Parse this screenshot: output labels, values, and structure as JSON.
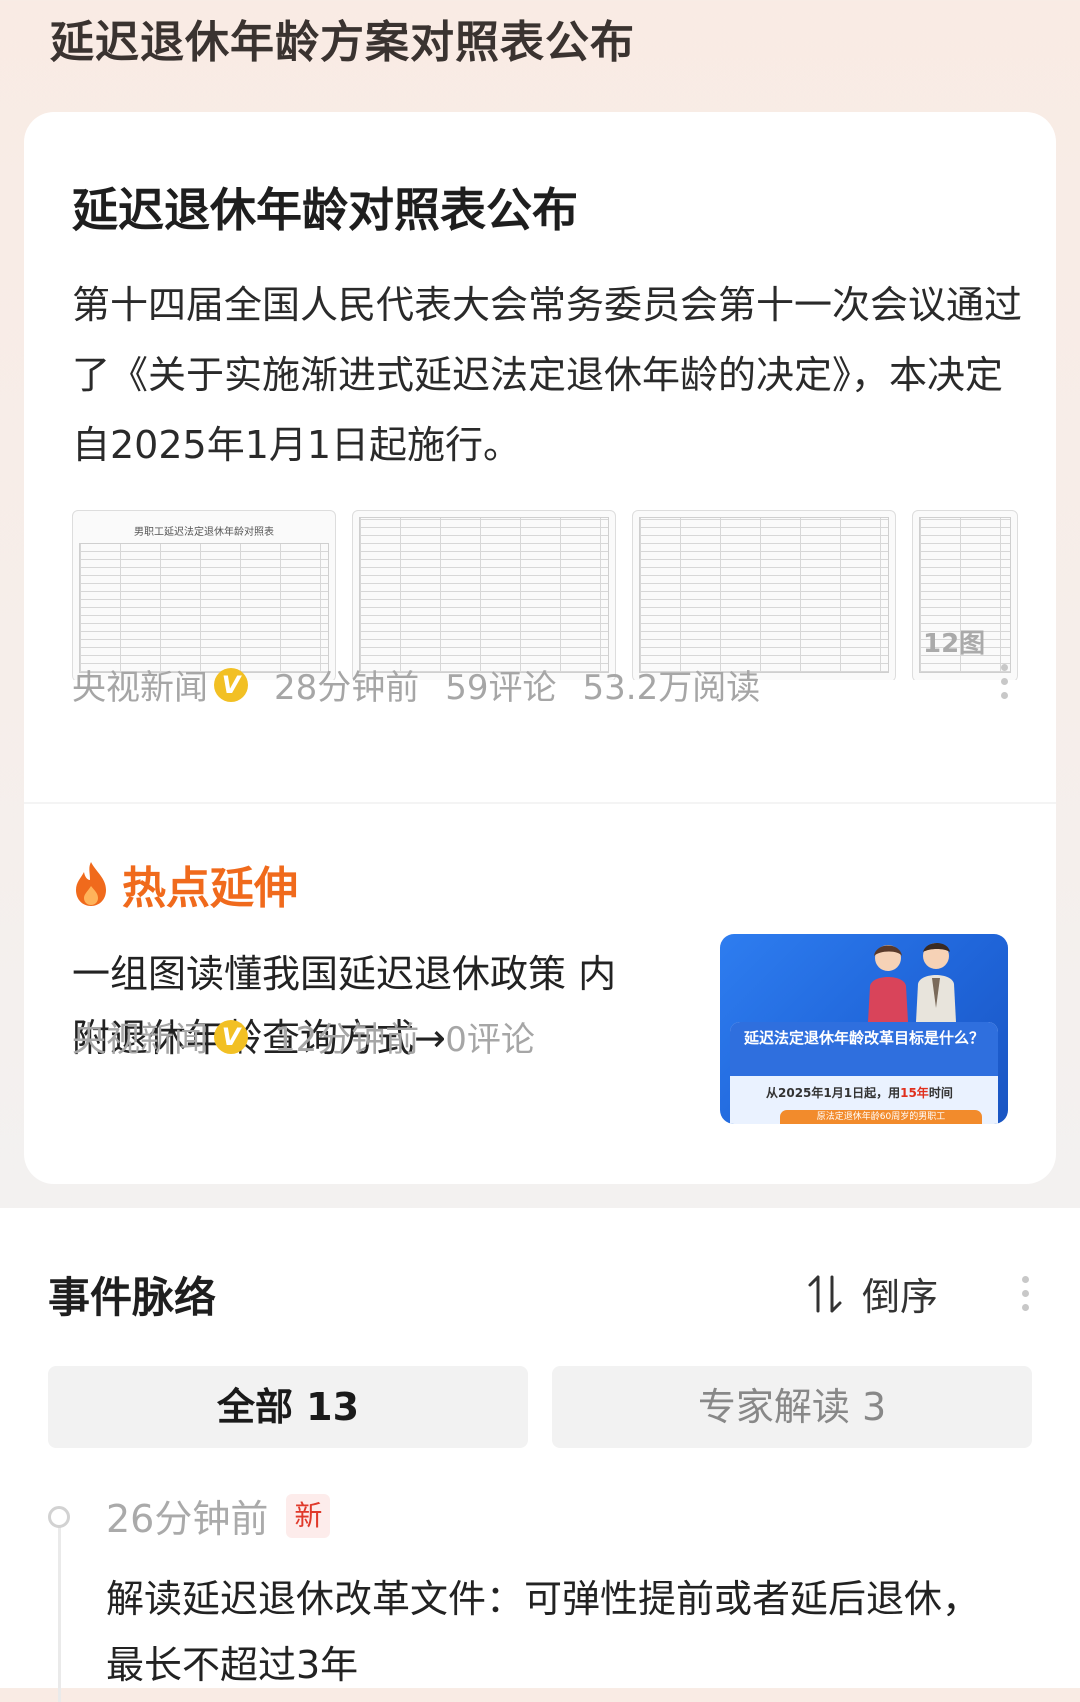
{
  "page_title": "延迟退休年龄方案对照表公布",
  "article": {
    "headline": "延迟退休年龄对照表公布",
    "summary": "第十四届全国人民代表大会常务委员会第十一次会议通过了《关于实施渐进式延迟法定退休年龄的决定》，本决定自2025年1月1日起施行。",
    "thumb_title": "男职工延迟法定退休年龄对照表",
    "image_count": "12图",
    "source": "央视新闻",
    "verified_badge": "V",
    "time": "28分钟前",
    "comments": "59评论",
    "reads": "53.2万阅读"
  },
  "hot_extension": {
    "heading": "热点延伸",
    "icon": "flame-icon",
    "title": "一组图读懂我国延迟退休政策 内附退休年龄查询方式→",
    "source": "央视新闻",
    "verified_badge": "V",
    "time": "12分钟前",
    "comments": "0评论",
    "image": {
      "title": "延迟法定退休年龄改革目标是什么？",
      "line_prefix": "从2025年1月1日起，用",
      "line_highlight": "15年",
      "line_suffix": "时间",
      "bar_text": "原法定退休年龄60周岁的男职工"
    }
  },
  "timeline": {
    "heading": "事件脉络",
    "sort_label": "倒序",
    "sort_icon": "sort-icon",
    "tabs": [
      {
        "label": "全部 13",
        "selected": true
      },
      {
        "label": "专家解读 3",
        "selected": false
      }
    ],
    "items": [
      {
        "time": "26分钟前",
        "badge": "新",
        "text": "解读延迟退休改革文件：可弹性提前或者延后退休，最长不超过3年"
      }
    ]
  },
  "colors": {
    "accent": "#f06a1c",
    "verified": "#f2c024",
    "new_badge": "#e0392a"
  }
}
